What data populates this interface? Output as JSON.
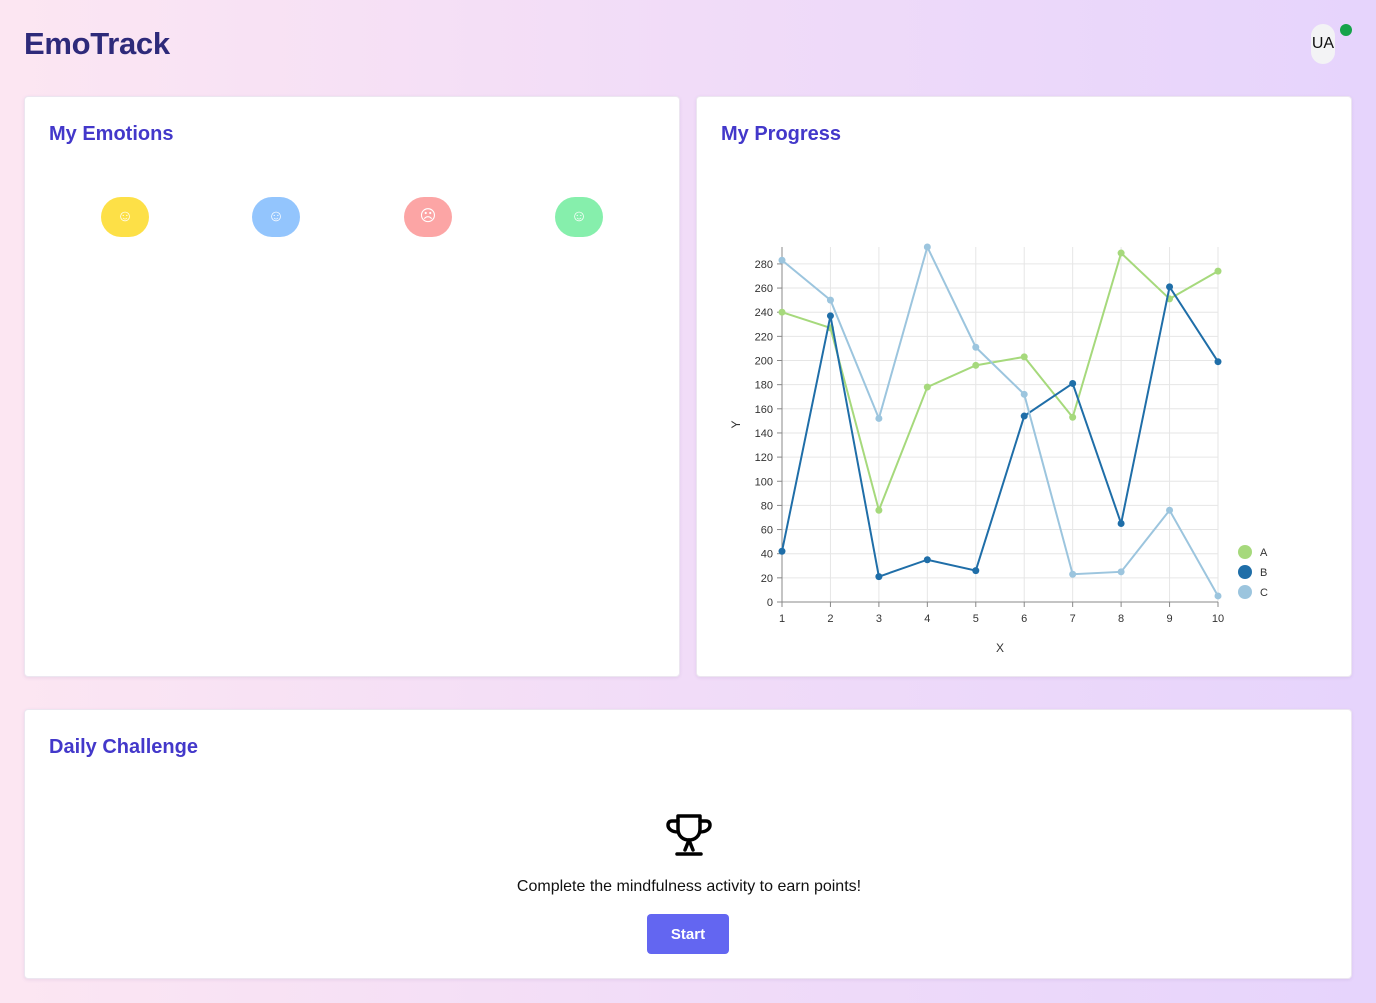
{
  "app": {
    "title": "EmoTrack"
  },
  "user": {
    "initials": "UA",
    "status_color": "#16a34a"
  },
  "emotions": {
    "title": "My Emotions",
    "items": [
      {
        "icon": "smile-icon",
        "glyph": "☺",
        "color": "#fde047"
      },
      {
        "icon": "smile-icon",
        "glyph": "☺",
        "color": "#93c5fd"
      },
      {
        "icon": "frown-icon",
        "glyph": "☹",
        "color": "#fca5a5"
      },
      {
        "icon": "smile-icon",
        "glyph": "☺",
        "color": "#86efac"
      }
    ]
  },
  "progress": {
    "title": "My Progress"
  },
  "chart_data": {
    "type": "line",
    "x": [
      1,
      2,
      3,
      4,
      5,
      6,
      7,
      8,
      9,
      10
    ],
    "series": [
      {
        "name": "A",
        "color": "#a6d97c",
        "values": [
          240,
          227,
          76,
          178,
          196,
          203,
          153,
          289,
          251,
          274
        ]
      },
      {
        "name": "B",
        "color": "#1f6ea8",
        "values": [
          42,
          237,
          21,
          35,
          26,
          154,
          181,
          65,
          261,
          199
        ]
      },
      {
        "name": "C",
        "color": "#9cc5de",
        "values": [
          283,
          250,
          152,
          294,
          211,
          172,
          23,
          25,
          76,
          5
        ]
      }
    ],
    "xlabel": "X",
    "ylabel": "Y",
    "ylim": [
      0,
      294
    ],
    "yticks": [
      0,
      20,
      40,
      60,
      80,
      100,
      120,
      140,
      160,
      180,
      200,
      220,
      240,
      260,
      280
    ],
    "grid": true,
    "legend": "right-bottom"
  },
  "challenge": {
    "title": "Daily Challenge",
    "icon": "trophy-icon",
    "text": "Complete the mindfulness activity to earn points!",
    "button_label": "Start",
    "button_color": "#6366f1"
  }
}
